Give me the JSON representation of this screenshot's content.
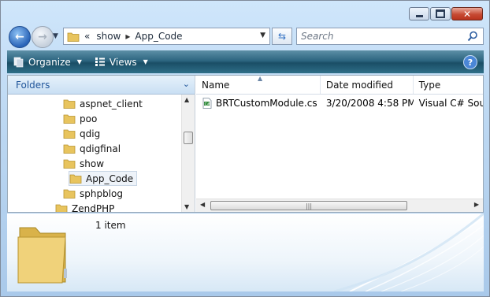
{
  "window": {
    "close_glyph": "✕"
  },
  "nav": {
    "breadcrumb": {
      "overflow": "«",
      "path": [
        "show",
        "App_Code"
      ]
    },
    "search_placeholder": "Search"
  },
  "toolbar": {
    "organize_label": "Organize",
    "views_label": "Views",
    "help_glyph": "?"
  },
  "folders_pane": {
    "header": "Folders",
    "items": [
      {
        "label": "aspnet_client"
      },
      {
        "label": "poo"
      },
      {
        "label": "qdig"
      },
      {
        "label": "qdigfinal"
      },
      {
        "label": "show"
      },
      {
        "label": "App_Code",
        "selected": true
      },
      {
        "label": "sphpblog"
      },
      {
        "label": "ZendPHP"
      }
    ]
  },
  "file_list": {
    "columns": [
      "Name",
      "Date modified",
      "Type"
    ],
    "rows": [
      {
        "name": "BRTCustomModule.cs",
        "date_modified": "3/20/2008 4:58 PM",
        "type": "Visual C# Sourc"
      }
    ]
  },
  "details_pane": {
    "item_count": "1 item"
  },
  "colors": {
    "accent": "#21569b",
    "command_bar": "#2c6580",
    "folder": "#e8c45e"
  }
}
